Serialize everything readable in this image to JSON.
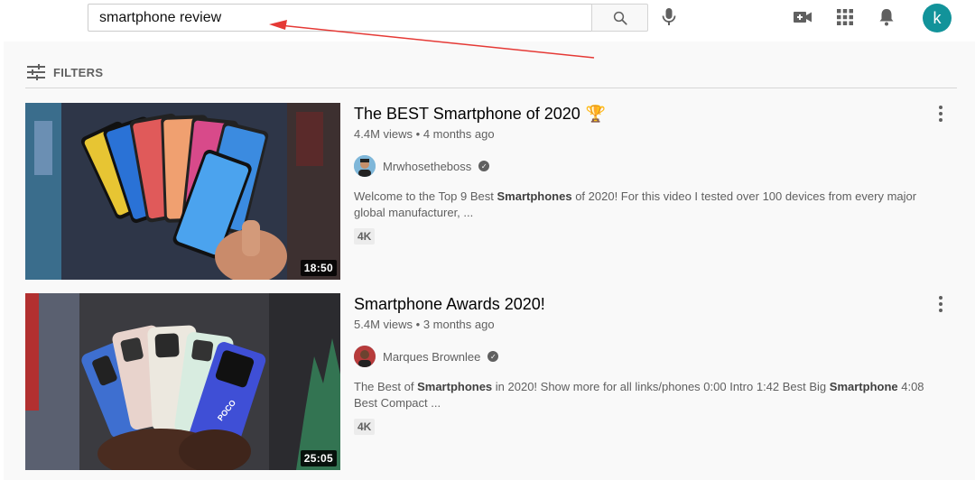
{
  "header": {
    "search": {
      "value": "smartphone review",
      "placeholder": "Search"
    },
    "icons": {
      "search": "search-icon",
      "mic": "mic-icon",
      "create": "video-camera-plus-icon",
      "apps": "apps-grid-icon",
      "notifications": "bell-icon"
    },
    "avatar_letter": "k",
    "avatar_color": "#12939a"
  },
  "filters": {
    "label": "FILTERS",
    "icon": "tune-icon"
  },
  "annotation": {
    "type": "red-arrow",
    "color": "#e53935"
  },
  "results": [
    {
      "title": "The BEST Smartphone of 2020",
      "title_emoji": "🏆",
      "views": "4.4M views",
      "age": "4 months ago",
      "channel": "Mrwhosetheboss",
      "verified": true,
      "description_parts": [
        {
          "text": "Welcome to the Top 9 Best ",
          "bold": false
        },
        {
          "text": "Smartphones",
          "bold": true
        },
        {
          "text": " of 2020! For this video I tested over 100 devices from every major global manufacturer, ...",
          "bold": false
        }
      ],
      "badge": "4K",
      "duration": "18:50"
    },
    {
      "title": "Smartphone Awards 2020!",
      "title_emoji": "",
      "views": "5.4M views",
      "age": "3 months ago",
      "channel": "Marques Brownlee",
      "verified": true,
      "description_parts": [
        {
          "text": "The Best of ",
          "bold": false
        },
        {
          "text": "Smartphones",
          "bold": true
        },
        {
          "text": " in 2020! Show more for all links/phones 0:00 Intro 1:42 Best Big ",
          "bold": false
        },
        {
          "text": "Smartphone",
          "bold": true
        },
        {
          "text": " 4:08 Best Compact ...",
          "bold": false
        }
      ],
      "badge": "4K",
      "duration": "25:05"
    }
  ]
}
